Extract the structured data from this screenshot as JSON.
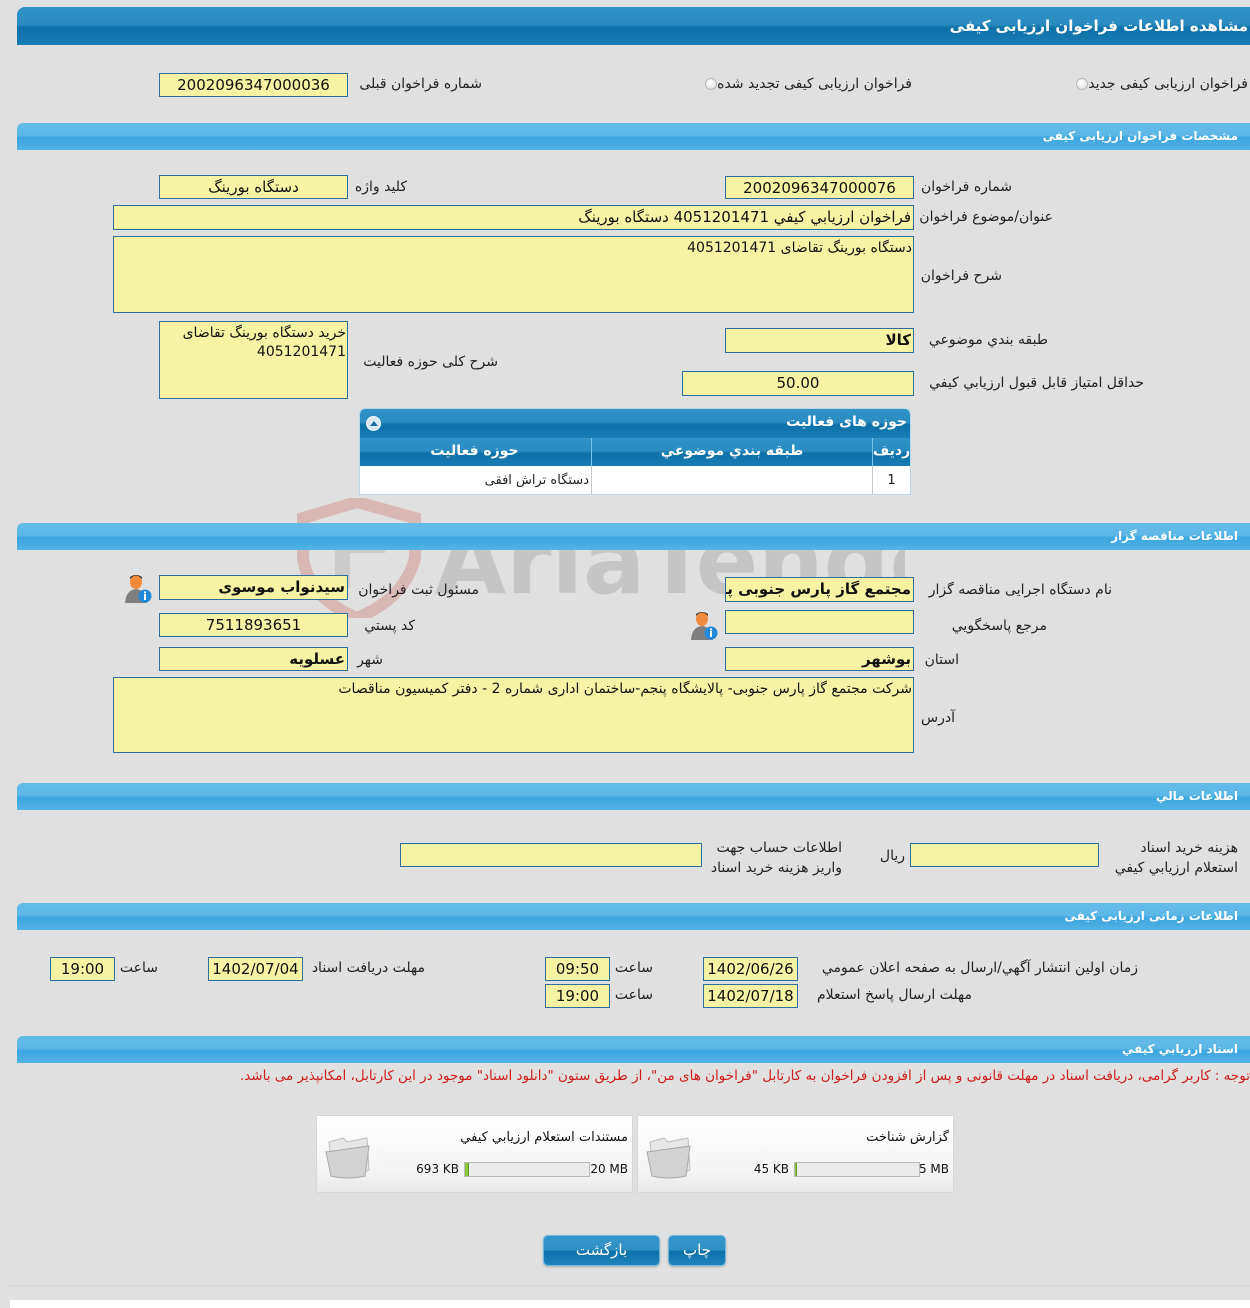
{
  "page": {
    "title": "مشاهده اطلاعات فراخوان ارزيابی کيفی"
  },
  "callType": {
    "option_new": "فراخوان ارزيابی کيفی جديد",
    "option_renewed": "فراخوان ارزيابی کيفی تجديد شده",
    "previous_number_label": "شماره فراخوان قبلی",
    "previous_number": "2002096347000036"
  },
  "specs": {
    "header": "مشخصات فراخوان ارزيابی کيفی",
    "number_label": "شماره فراخوان",
    "number": "2002096347000076",
    "keyword_label": "کليد واژه",
    "keyword": "دستگاه بورینگ",
    "subject_label": "عنوان/موضوع فراخوان",
    "subject": "فراخوان ارزيابي كيفي 4051201471 دستگاه بورينگ",
    "description_label": "شرح فراخوان",
    "description": "دستگاه بورینگ تقاضای 4051201471",
    "category_label": "طبقه بندي موضوعي",
    "category": "کالا",
    "activity_desc_label": "شرح کلی حوزه فعالیت",
    "activity_desc": "خرید دستگاه بورینگ تقاضای 4051201471",
    "min_score_label": "حداقل امتياز قابل قبول ارزيابي كيفي",
    "min_score": "50.00"
  },
  "activityGrid": {
    "title": "حوزه های فعالیت",
    "columns": [
      "رديف",
      "طبقه بندي موضوعي",
      "حوزه فعالیت"
    ],
    "rows": [
      {
        "index": "1",
        "category": "",
        "activity": "دستگاه تراش افقی"
      }
    ]
  },
  "tenderer": {
    "header": "اطلاعات مناقصه گزار",
    "org_label": "نام دستگاه اجرایی مناقصه گزار",
    "org": "مجتمع گاز پارس جنوبی  پالایشگاه پنجم",
    "registrar_label": "مسئول ثبت فراخوان",
    "registrar": "سیدنواب موسوی",
    "reference_label": "مرجع پاسخگويي",
    "reference": "",
    "postal_label": "کد پستي",
    "postal": "7511893651",
    "province_label": "استان",
    "province": "بوشهر",
    "city_label": "شهر",
    "city": "عسلویه",
    "address_label": "آدرس",
    "address": "شرکت مجتمع گاز پارس جنوبی- پالایشگاه پنجم-ساختمان اداری شماره 2 -  دفتر کمیسیون مناقصات"
  },
  "financial": {
    "header": "اطلاعات مالي",
    "fee_label_1": "هزينه خريد اسناد",
    "fee_label_2": "استعلام ارزيابي کيفي",
    "fee": "",
    "currency": "ريال",
    "account_label_1": "اطلاعات حساب جهت",
    "account_label_2": "واريز هزينه خريد اسناد",
    "account": ""
  },
  "timing": {
    "header": "اطلاعات زمانی ارزيابی کيفی",
    "publish_label": "زمان اولين انتشار آگهي/ارسال به صفحه اعلان عمومي",
    "publish_date": "1402/06/26",
    "publish_time": "09:50",
    "response_label": "مهلت ارسال پاسخ استعلام",
    "response_date": "1402/07/18",
    "response_time": "19:00",
    "receive_label": "مهلت دريافت اسناد",
    "receive_date": "1402/07/04",
    "receive_time": "19:00",
    "time_label": "ساعت"
  },
  "documents": {
    "header": "اسناد ارزيابي کيفي",
    "notice": "توجه : کاربر گرامی، دریافت اسناد در مهلت قانونی و پس از افزودن فراخوان به کارتابل \"فراخوان های من\"، از طریق ستون \"دانلود اسناد\" موجود در این کارتابل، امکانپذیر می باشد.",
    "files": [
      {
        "title": "گزارش شناخت",
        "size": "45 KB",
        "max": "5 MB",
        "fill_fraction": 0.009
      },
      {
        "title": "مستندات استعلام ارزيابي کيفي",
        "size": "693 KB",
        "max": "20 MB",
        "fill_fraction": 0.034
      }
    ]
  },
  "actions": {
    "print_label": "چاپ",
    "back_label": "بازگشت"
  },
  "watermark": {
    "text": "AriaTender.neT"
  },
  "colors": {
    "field_bg": "#f6f4a4",
    "header_blue": "#0c71a8",
    "section_blue": "#3aa6df",
    "notice_red": "#d01c1c",
    "progress_green": "#8fc43d"
  }
}
